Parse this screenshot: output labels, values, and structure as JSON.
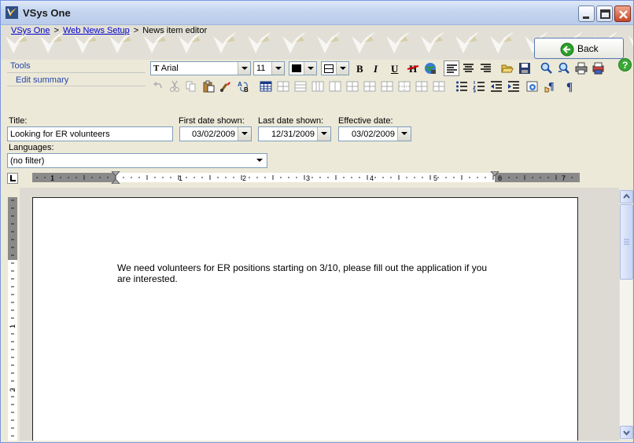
{
  "window": {
    "title": "VSys One"
  },
  "breadcrumb": [
    {
      "label": "VSys One",
      "link": true
    },
    {
      "label": "Web News Setup",
      "link": true
    },
    {
      "label": "News item editor",
      "link": false
    }
  ],
  "breadcrumb_separator": ">",
  "back_button": {
    "label": "Back"
  },
  "tools": {
    "label": "Tools",
    "edit_summary": "Edit summary"
  },
  "toolbar": {
    "font_family": "Arial",
    "font_size": "11",
    "bold": "B",
    "italic": "I",
    "underline": "U"
  },
  "form": {
    "title_label": "Title:",
    "title_value": "Looking for ER volunteers",
    "first_date_label": "First date shown:",
    "first_date_value": "03/02/2009",
    "last_date_label": "Last date shown:",
    "last_date_value": "12/31/2009",
    "effective_date_label": "Effective date:",
    "effective_date_value": "03/02/2009",
    "languages_label": "Languages:",
    "languages_value": "(no filter)"
  },
  "ruler": {
    "h_numbers": [
      "1",
      "1",
      "2",
      "3",
      "4",
      "5",
      "6",
      "7"
    ],
    "v_numbers": [
      "1",
      "2"
    ]
  },
  "document": {
    "text": "We need volunteers for ER positions starting on 3/10, please fill out the application if you are interested."
  },
  "colors": {
    "link": "#0000cc",
    "tools_link": "#2546a8",
    "titlebar": "#c6d6f0",
    "back_icon": "#2aa02a"
  }
}
